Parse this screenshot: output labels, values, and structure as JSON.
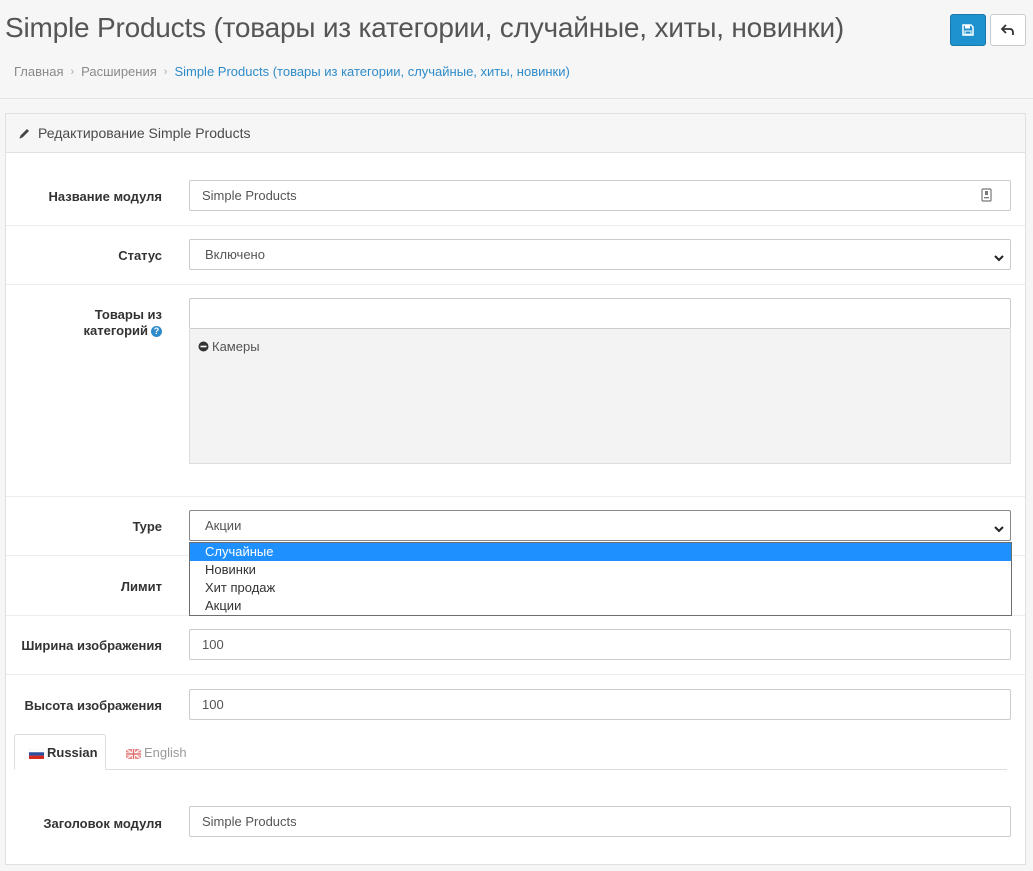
{
  "header": {
    "title": "Simple Products (товары из категории, случайные, хиты, новинки)",
    "breadcrumb": [
      "Главная",
      "Расширения",
      "Simple Products (товары из категории, случайные, хиты, новинки)"
    ]
  },
  "panel": {
    "heading": "Редактирование Simple Products"
  },
  "form": {
    "module_name": {
      "label": "Название модуля",
      "value": "Simple Products"
    },
    "status": {
      "label": "Статус",
      "value": "Включено"
    },
    "categories": {
      "label_line1": "Товары из",
      "label_line2": "категорий",
      "help_icon": "?",
      "input_value": "",
      "items": [
        "Камеры"
      ]
    },
    "type": {
      "label": "Type",
      "value": "Акции",
      "options": [
        "Случайные",
        "Новинки",
        "Хит продаж",
        "Акции"
      ],
      "highlighted": "Случайные"
    },
    "limit": {
      "label": "Лимит"
    },
    "image_width": {
      "label": "Ширина изображения",
      "value": "100"
    },
    "image_height": {
      "label": "Высота изображения",
      "value": "100"
    },
    "languages": {
      "tabs": [
        "Russian",
        "English"
      ],
      "active": "Russian"
    },
    "module_heading": {
      "label": "Заголовок модуля",
      "value": "Simple Products"
    }
  },
  "colors": {
    "accent": "#1e91cf",
    "link": "#2e8bc9",
    "dropdown_highlight": "#1e90ff"
  },
  "icons": {
    "save": "save-icon",
    "back": "reply-icon",
    "pencil": "pencil-icon",
    "minus": "minus-circle-icon",
    "help": "question-circle-icon"
  }
}
